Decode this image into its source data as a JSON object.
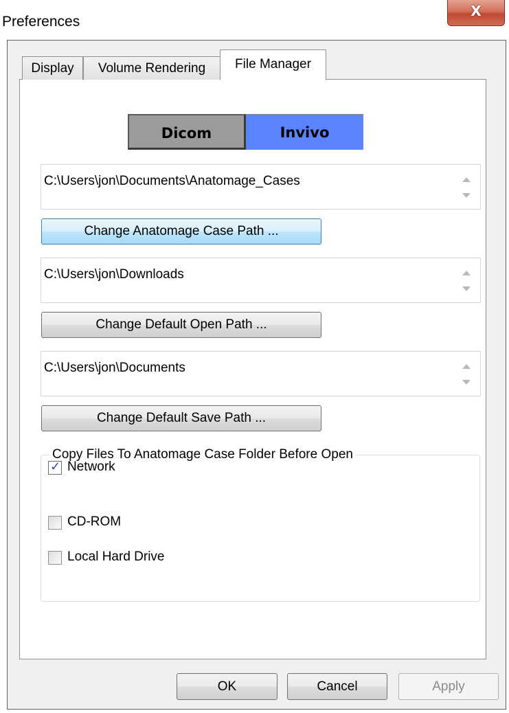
{
  "window": {
    "title": "Preferences",
    "close_label": "X"
  },
  "tabs": [
    {
      "label": "Display",
      "active": false
    },
    {
      "label": "Volume Rendering",
      "active": false
    },
    {
      "label": "File Manager",
      "active": true
    }
  ],
  "segment": {
    "dicom_label": "Dicom",
    "invivo_label": "Invivo",
    "selected": "Invivo",
    "colors": {
      "dicom": "#9b9b9b",
      "invivo": "#5b82ff"
    }
  },
  "paths": {
    "case_path": "C:\\Users\\jon\\Documents\\Anatomage_Cases",
    "open_path": "C:\\Users\\jon\\Downloads",
    "save_path": "C:\\Users\\jon\\Documents"
  },
  "buttons": {
    "change_case": "Change Anatomage Case Path ...",
    "change_open": "Change Default Open Path ...",
    "change_save": "Change Default Save Path ..."
  },
  "copy_group": {
    "legend": "Copy Files To Anatomage Case Folder Before Open",
    "options": [
      {
        "label": "Network",
        "checked": true
      },
      {
        "label": "CD-ROM",
        "checked": false
      },
      {
        "label": "Local Hard Drive",
        "checked": false
      }
    ]
  },
  "footer": {
    "ok": "OK",
    "cancel": "Cancel",
    "apply": "Apply",
    "apply_enabled": false
  }
}
